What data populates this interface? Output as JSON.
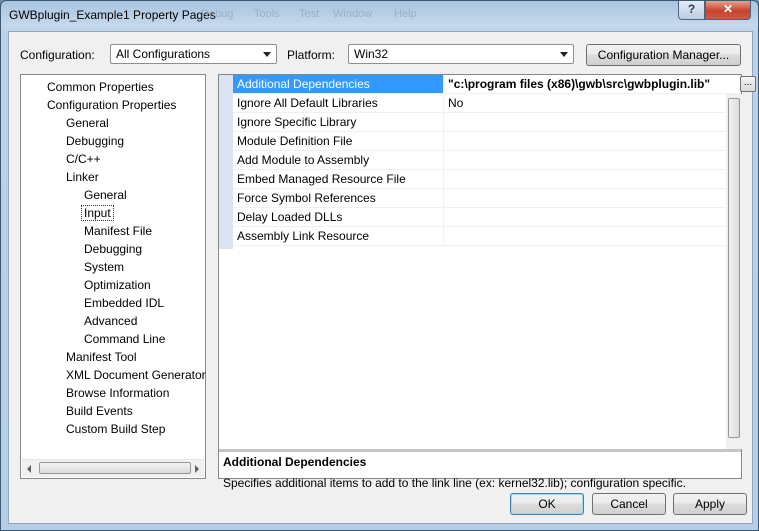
{
  "window": {
    "title": "GWBplugin_Example1 Property Pages",
    "ghost_menu": [
      "Debug",
      "Tools",
      "Test",
      "Window",
      "Help"
    ],
    "help_glyph": "?",
    "close_glyph": "✕"
  },
  "header": {
    "configuration_label": "Configuration:",
    "configuration_value": "All Configurations",
    "platform_label": "Platform:",
    "platform_value": "Win32",
    "config_manager_label": "Configuration Manager..."
  },
  "tree": {
    "items": [
      {
        "label": "Common Properties",
        "level": 0
      },
      {
        "label": "Configuration Properties",
        "level": 0
      },
      {
        "label": "General",
        "level": 1
      },
      {
        "label": "Debugging",
        "level": 1
      },
      {
        "label": "C/C++",
        "level": 1
      },
      {
        "label": "Linker",
        "level": 1
      },
      {
        "label": "General",
        "level": 2
      },
      {
        "label": "Input",
        "level": 2,
        "selected": true
      },
      {
        "label": "Manifest File",
        "level": 2
      },
      {
        "label": "Debugging",
        "level": 2
      },
      {
        "label": "System",
        "level": 2
      },
      {
        "label": "Optimization",
        "level": 2
      },
      {
        "label": "Embedded IDL",
        "level": 2
      },
      {
        "label": "Advanced",
        "level": 2
      },
      {
        "label": "Command Line",
        "level": 2
      },
      {
        "label": "Manifest Tool",
        "level": 1
      },
      {
        "label": "XML Document Generator",
        "level": 1
      },
      {
        "label": "Browse Information",
        "level": 1
      },
      {
        "label": "Build Events",
        "level": 1
      },
      {
        "label": "Custom Build Step",
        "level": 1
      }
    ]
  },
  "properties": {
    "rows": [
      {
        "name": "Additional Dependencies",
        "value": "\"c:\\program files (x86)\\gwb\\src\\gwbplugin.lib\"",
        "selected": true
      },
      {
        "name": "Ignore All Default Libraries",
        "value": "No"
      },
      {
        "name": "Ignore Specific Library",
        "value": ""
      },
      {
        "name": "Module Definition File",
        "value": ""
      },
      {
        "name": "Add Module to Assembly",
        "value": ""
      },
      {
        "name": "Embed Managed Resource File",
        "value": ""
      },
      {
        "name": "Force Symbol References",
        "value": ""
      },
      {
        "name": "Delay Loaded DLLs",
        "value": ""
      },
      {
        "name": "Assembly Link Resource",
        "value": ""
      }
    ],
    "ellipsis_label": "..."
  },
  "description": {
    "title": "Additional Dependencies",
    "body": "Specifies additional items to add to the link line (ex: kernel32.lib); configuration specific."
  },
  "buttons": {
    "ok": "OK",
    "cancel": "Cancel",
    "apply": "Apply"
  }
}
